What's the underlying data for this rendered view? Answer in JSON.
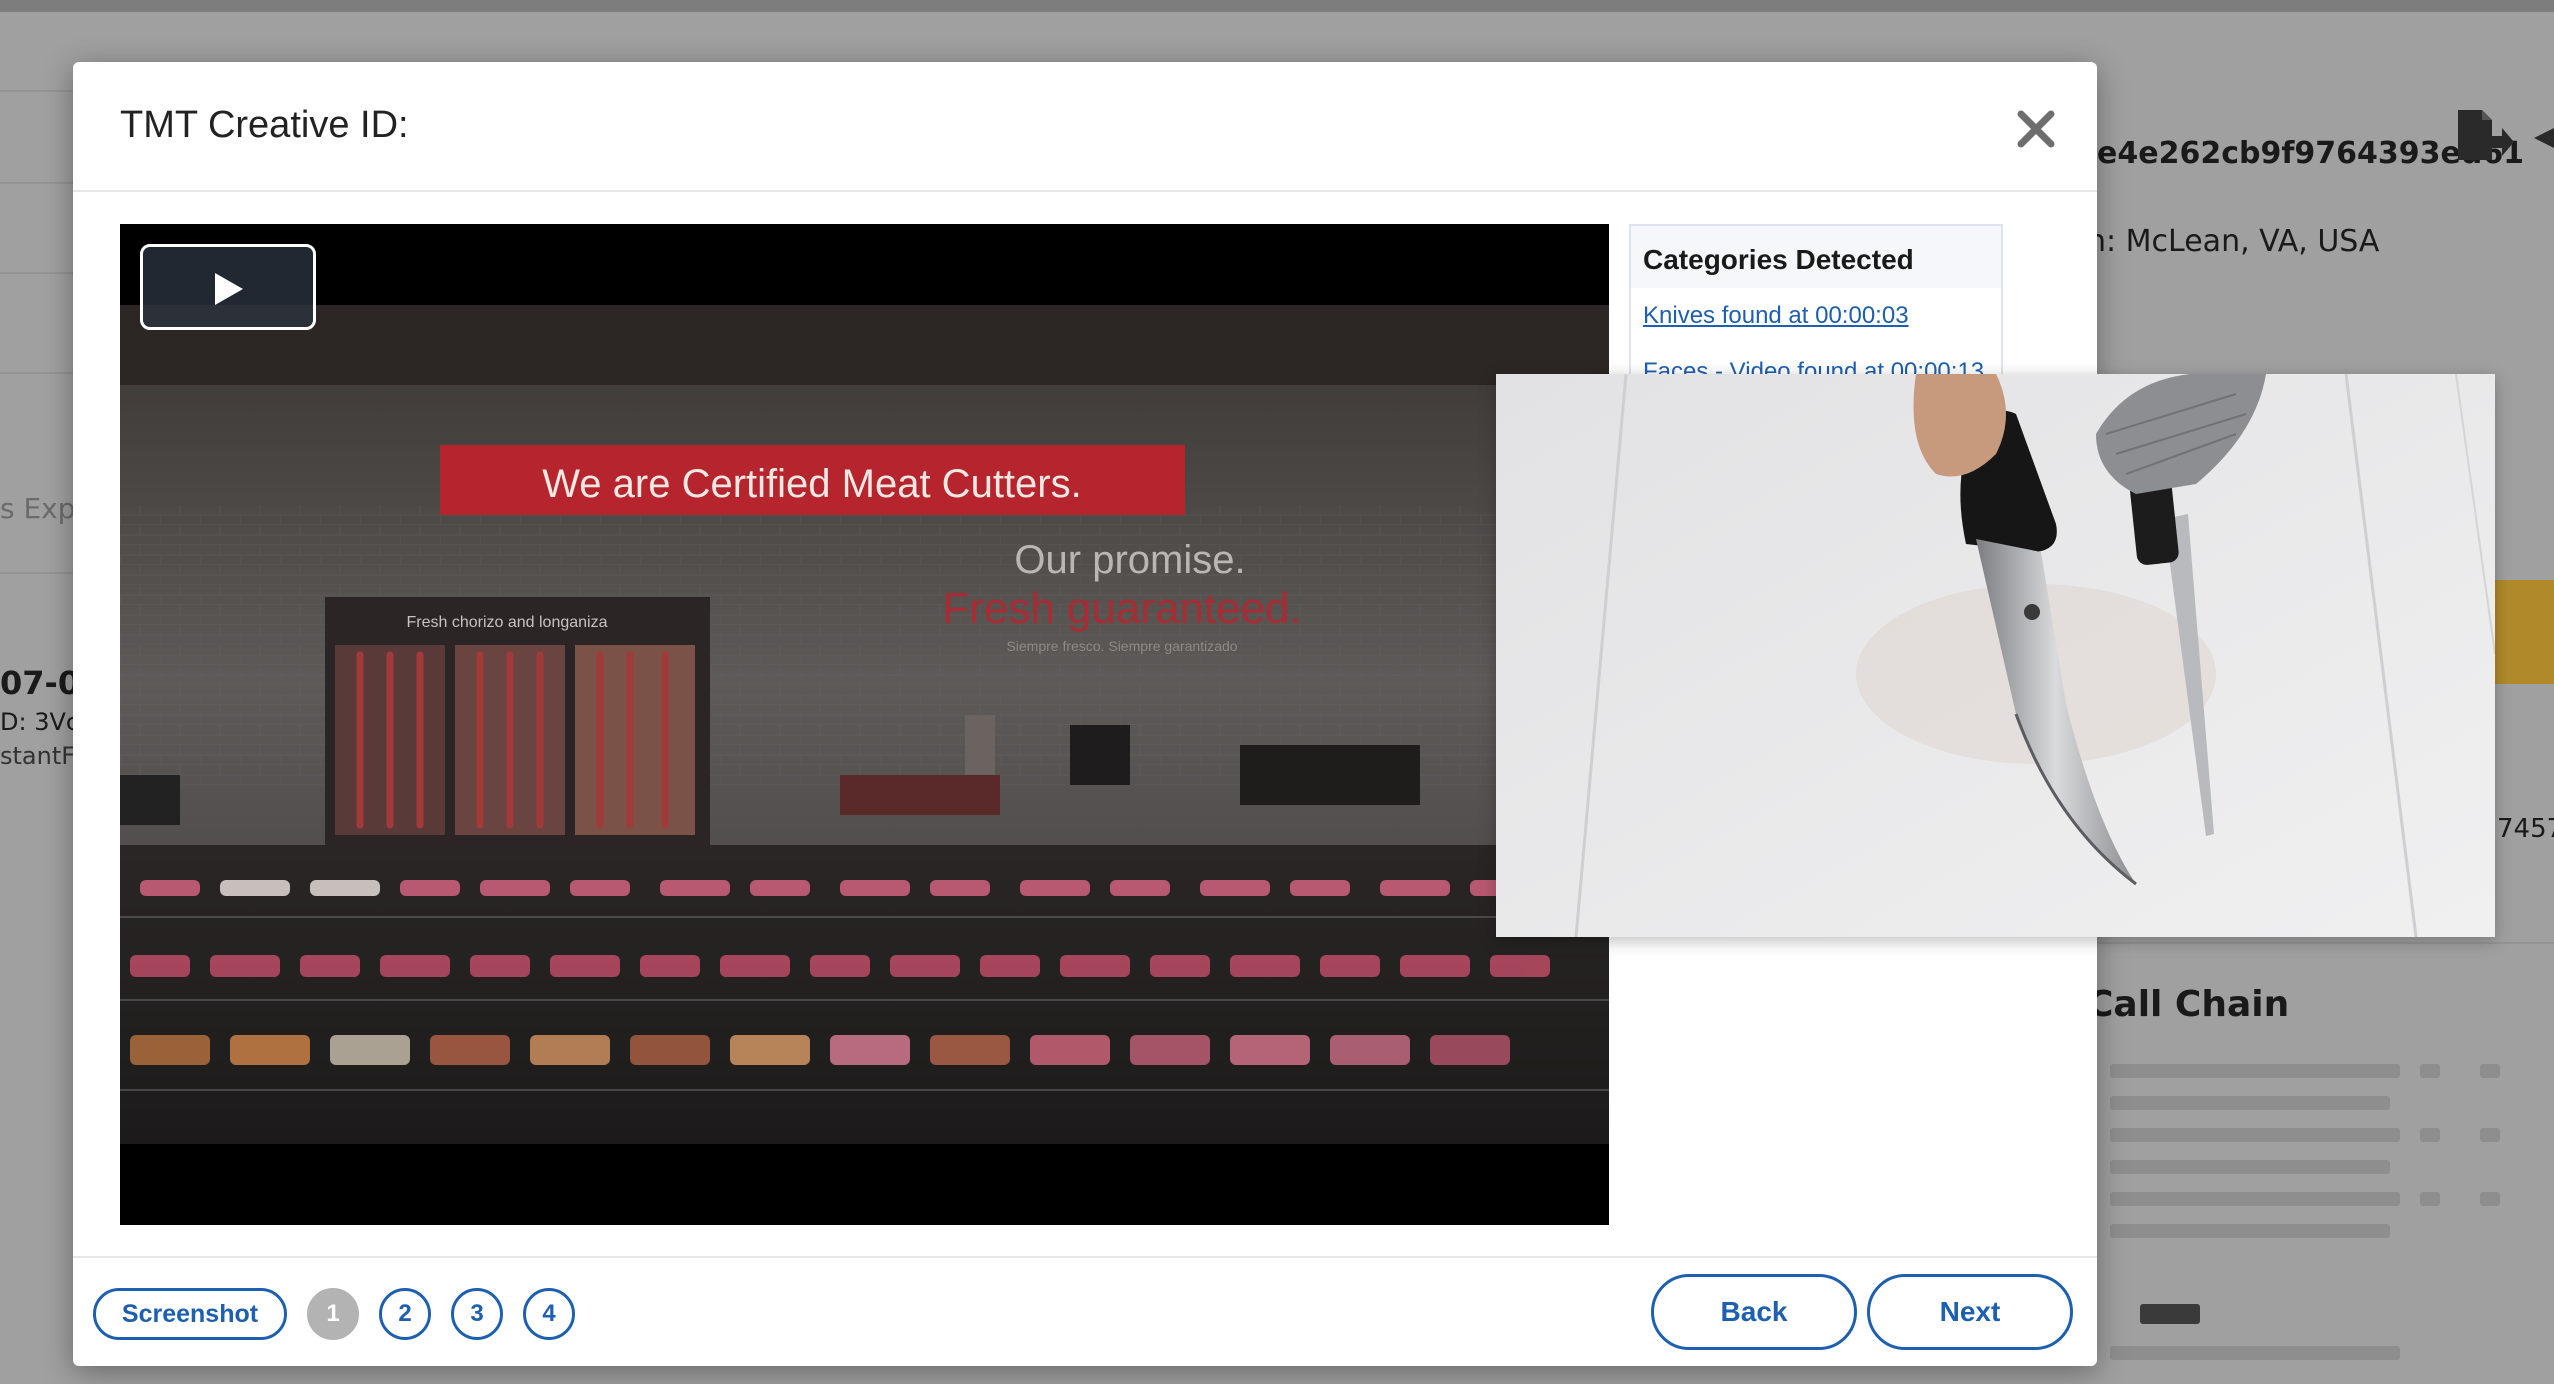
{
  "background": {
    "hash_fragment": "e4e262cb9f9764393ed61",
    "location_fragment": "n: McLean, VA, USA",
    "left_fragment_1": "s Exp",
    "left_fragment_2": "07-0",
    "left_fragment_3": "D: 3Vc",
    "left_fragment_4": "stantF",
    "right_number_fragment": "7457",
    "section_title": "Call Chain",
    "accent_color": "#b08a2a"
  },
  "modal": {
    "title": "TMT Creative ID:",
    "close_icon": "close-icon",
    "video": {
      "play_icon": "play-icon",
      "scene_sign": "We are Certified Meat Cutters.",
      "scene_promise_line1": "Our promise.",
      "scene_promise_line2": "Fresh guaranteed.",
      "scene_promise_sub": "Siempre fresco. Siempre garantizado",
      "scene_case_label": "Fresh chorizo and longaniza"
    },
    "categories": {
      "heading": "Categories Detected",
      "items": [
        "Knives found at 00:00:03",
        "Faces - Video found at 00:00:13"
      ]
    },
    "footer": {
      "screenshot_label": "Screenshot",
      "pages": [
        "1",
        "2",
        "3",
        "4"
      ],
      "active_page": "1",
      "back_label": "Back",
      "next_label": "Next",
      "accent_color": "#1d5fb0"
    }
  }
}
